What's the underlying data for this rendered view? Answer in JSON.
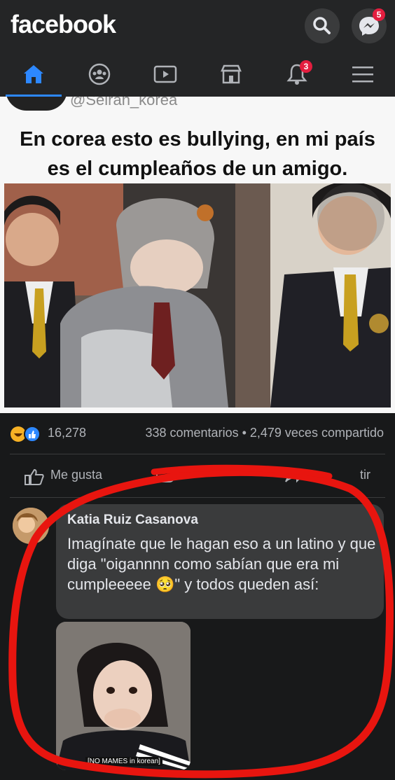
{
  "app": {
    "logo": "facebook"
  },
  "header": {
    "messenger_badge": "5",
    "notifications_badge": "3"
  },
  "nav": {
    "tabs": [
      {
        "name": "home",
        "active": true
      },
      {
        "name": "groups"
      },
      {
        "name": "watch"
      },
      {
        "name": "marketplace"
      },
      {
        "name": "notifications"
      },
      {
        "name": "menu"
      }
    ]
  },
  "post": {
    "handle": "@Seiran_korea",
    "caption_line1": "En corea esto es bullying, en mi país",
    "caption_line2": "es el cumpleaños de un amigo.",
    "reactions_count": "16,278",
    "share_stats": "338 comentarios • 2,479 veces compartido"
  },
  "actions": {
    "like_label": "Me gusta",
    "share_suffix": "tir"
  },
  "comment": {
    "author": "Katia Ruiz Casanova",
    "text": "Imagínate que le hagan eso a un latino y que diga \"oigannnn como sabían que era mi cumpleeeee 🥺\" y todos queden así:",
    "image_caption": "[NO MAMES in korean]"
  },
  "colors": {
    "background": "#18191a",
    "accent": "#2d88ff",
    "badge": "#e41e3f",
    "annotation": "#e8150f"
  }
}
